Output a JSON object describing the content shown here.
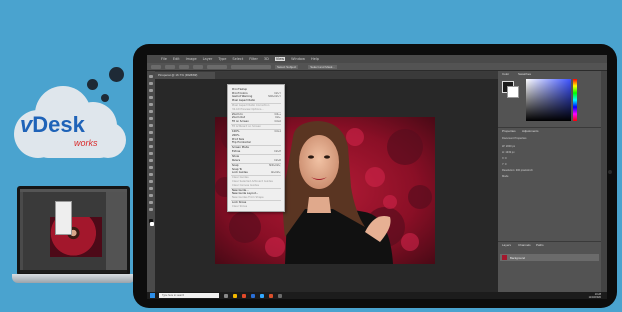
{
  "logo": {
    "brand_v": "v",
    "brand_rest": "Desk",
    "tagline": "works",
    "colors": {
      "cloud": "#dfe6ec",
      "brand_blue": "#1f63b8",
      "brand_red": "#d92b2b"
    }
  },
  "app": {
    "menu": [
      "File",
      "Edit",
      "Image",
      "Layer",
      "Type",
      "Select",
      "Filter",
      "3D",
      "View",
      "Window",
      "Help"
    ],
    "document_tab": "Pinsperat @ 16.7% (RGB/8#)",
    "options_buttons": [
      "Select Subject",
      "Select and Mask..."
    ],
    "open_menu": "View",
    "menu_items": [
      {
        "label": "Proof Setup",
        "shortcut": "",
        "disabled": false
      },
      {
        "label": "Proof Colors",
        "shortcut": "Ctrl+Y",
        "disabled": false
      },
      {
        "label": "Gamut Warning",
        "shortcut": "Shift+Ctrl+Y",
        "disabled": false
      },
      {
        "label": "Pixel Aspect Ratio",
        "shortcut": "",
        "disabled": false
      },
      {
        "label": "Pixel Aspect Ratio Correction",
        "shortcut": "",
        "disabled": true
      },
      {
        "label": "32-bit Preview Options...",
        "shortcut": "",
        "disabled": true
      },
      {
        "label": "Zoom In",
        "shortcut": "Ctrl++",
        "disabled": false
      },
      {
        "label": "Zoom Out",
        "shortcut": "Ctrl+-",
        "disabled": false
      },
      {
        "label": "Fit on Screen",
        "shortcut": "Ctrl+0",
        "disabled": false
      },
      {
        "label": "Fit Artboard on Screen",
        "shortcut": "",
        "disabled": true
      },
      {
        "label": "100%",
        "shortcut": "Ctrl+1",
        "disabled": false
      },
      {
        "label": "200%",
        "shortcut": "",
        "disabled": false
      },
      {
        "label": "Print Size",
        "shortcut": "",
        "disabled": false
      },
      {
        "label": "Flip Horizontal",
        "shortcut": "",
        "disabled": false
      },
      {
        "label": "Screen Mode",
        "shortcut": "",
        "disabled": false
      },
      {
        "label": "Extras",
        "shortcut": "Ctrl+H",
        "disabled": false
      },
      {
        "label": "Show",
        "shortcut": "",
        "disabled": false
      },
      {
        "label": "Rulers",
        "shortcut": "Ctrl+R",
        "disabled": false
      },
      {
        "label": "Snap",
        "shortcut": "Shift+Ctrl+;",
        "disabled": false
      },
      {
        "label": "Snap To",
        "shortcut": "",
        "disabled": false
      },
      {
        "label": "Lock Guides",
        "shortcut": "Alt+Ctrl+;",
        "disabled": false
      },
      {
        "label": "Clear Guides",
        "shortcut": "",
        "disabled": true
      },
      {
        "label": "Clear Selected Artboard Guides",
        "shortcut": "",
        "disabled": true
      },
      {
        "label": "Clear Canvas Guides",
        "shortcut": "",
        "disabled": true
      },
      {
        "label": "New Guide...",
        "shortcut": "",
        "disabled": false
      },
      {
        "label": "New Guide Layout...",
        "shortcut": "",
        "disabled": false
      },
      {
        "label": "New Guides From Shape",
        "shortcut": "",
        "disabled": true
      },
      {
        "label": "Lock Slices",
        "shortcut": "",
        "disabled": false
      },
      {
        "label": "Clear Slices",
        "shortcut": "",
        "disabled": true
      }
    ],
    "panels": {
      "color_tabs": [
        "Color",
        "Swatches"
      ],
      "properties_tabs": [
        "Properties",
        "Adjustments"
      ],
      "properties_title": "Document Properties",
      "properties_rows": [
        "W: 2000 px",
        "H: 1333 px",
        "X: 0",
        "Y: 0",
        "Resolution: 300 pixels/inch",
        "Mode"
      ],
      "layers_tabs": [
        "Layers",
        "Channels",
        "Paths"
      ],
      "layer_name": "Background"
    },
    "taskbar": {
      "search_placeholder": "Type here to search",
      "time": "10:28",
      "date": "11/18/2020"
    }
  }
}
